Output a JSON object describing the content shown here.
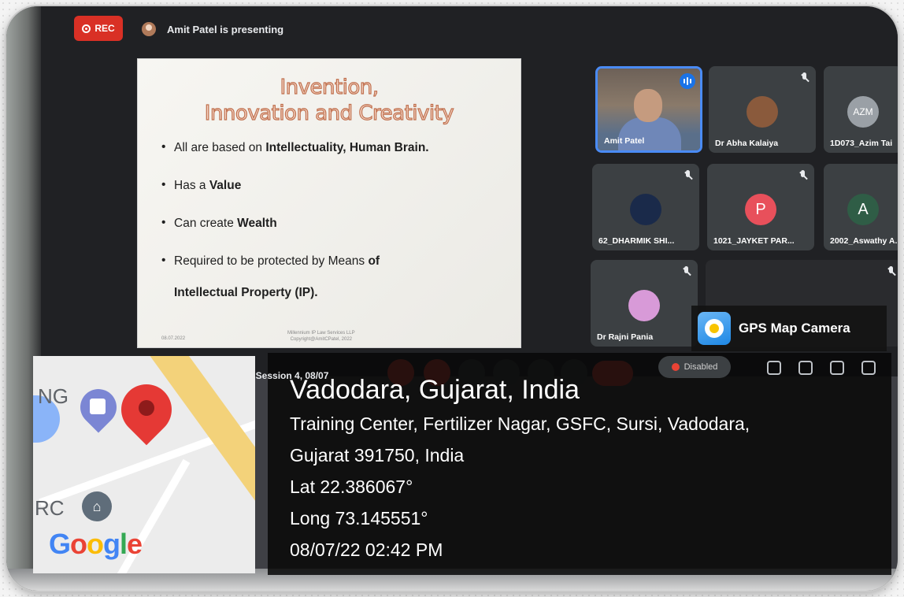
{
  "meeting": {
    "rec_label": "REC",
    "presenter_text": "Amit Patel is presenting",
    "session_text": ", Session 4, 08/07",
    "disabled_label": "Disabled"
  },
  "slide": {
    "title_line1": "Invention,",
    "title_line2": "Innovation and Creativity",
    "bullets": [
      {
        "pre": "All are based on ",
        "bold": "Intellectuality, Human Brain."
      },
      {
        "pre": "Has a ",
        "bold": "Value"
      },
      {
        "pre": "Can create ",
        "bold": "Wealth"
      },
      {
        "pre": "Required to be protected by Means ",
        "bold": "of",
        "cont": "Intellectual Property (IP)."
      }
    ],
    "footer_left": "08.07.2022",
    "footer_mid_1": "Millennium IP Law Services LLP",
    "footer_mid_2": "Copyright@AmitCPatel, 2022"
  },
  "participants": [
    {
      "name": "Amit Patel",
      "initial": "",
      "color": "",
      "speaking": true
    },
    {
      "name": "Dr Abha Kalaiya",
      "initial": "",
      "color": "#8a5a3c"
    },
    {
      "name": "1D073_Azim Tai",
      "initial": "AZM",
      "color": "#9aa0a6"
    },
    {
      "name": "62_DHARMIK SHI...",
      "initial": "",
      "color": "#1a2a4a"
    },
    {
      "name": "1021_JAYKET PAR...",
      "initial": "P",
      "color": "#e8505b"
    },
    {
      "name": "2002_Aswathy A...",
      "initial": "A",
      "color": "#2f5d46"
    },
    {
      "name": "Dr Rajni Pania",
      "initial": "",
      "color": "#d89ad8"
    }
  ],
  "gps": {
    "app_name": "GPS Map Camera",
    "city": "Vadodara, Gujarat, India",
    "address_line1": "Training Center, Fertilizer Nagar, GSFC, Sursi, Vadodara,",
    "address_line2": "Gujarat 391750, India",
    "lat": "Lat 22.386067°",
    "long": "Long 73.145551°",
    "datetime": "08/07/22 02:42 PM"
  },
  "map": {
    "label_ng": "NG",
    "label_rc": "RC",
    "google": [
      "G",
      "o",
      "o",
      "g",
      "l",
      "e"
    ]
  },
  "colors": {
    "rec": "#d93025",
    "speaking_border": "#4a8bf5",
    "end_call": "#ea4335"
  }
}
